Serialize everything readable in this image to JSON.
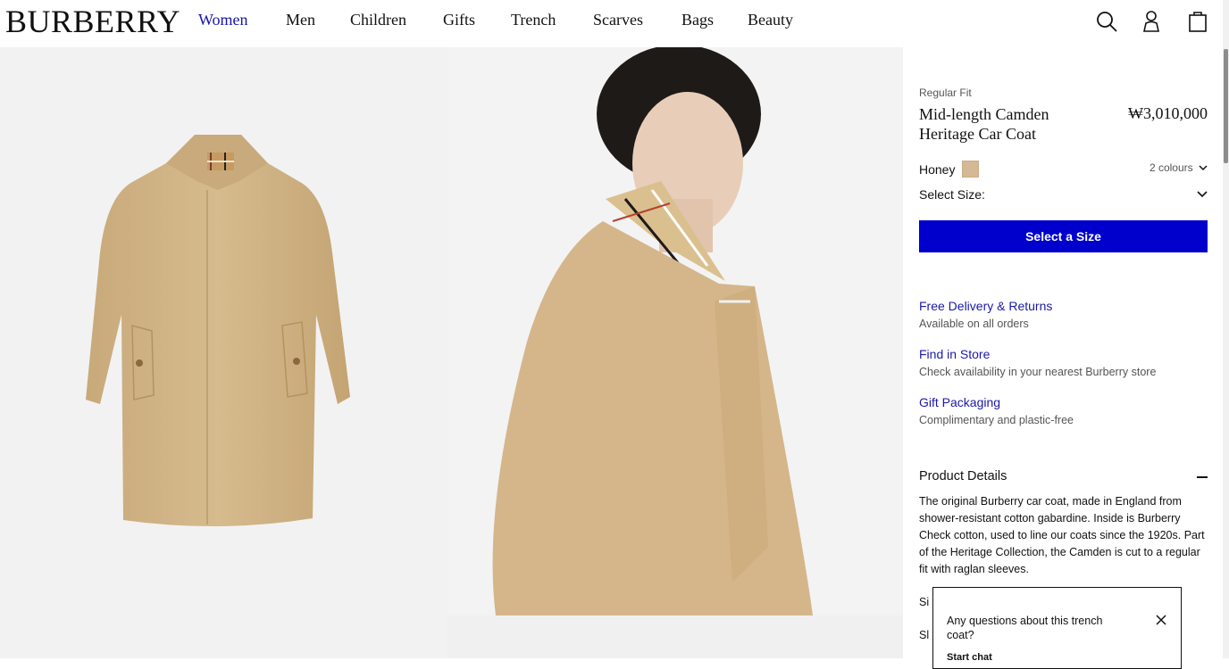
{
  "brand": {
    "logo": "BURBERRY"
  },
  "nav": {
    "items": [
      "Women",
      "Men",
      "Children",
      "Gifts",
      "Trench",
      "Scarves",
      "Bags",
      "Beauty"
    ],
    "active": "Women"
  },
  "header_icons": [
    "search-icon",
    "account-icon",
    "bag-icon"
  ],
  "product": {
    "fit": "Regular Fit",
    "name": "Mid-length Camden Heritage Car Coat",
    "price": "₩3,010,000",
    "colour": "Honey",
    "colour_hex": "#d4b994",
    "colours_link": "2 colours",
    "size_label": "Select Size:",
    "cta": "Select a Size"
  },
  "services": [
    {
      "title": "Free Delivery & Returns",
      "sub": "Available on all orders"
    },
    {
      "title": "Find in Store",
      "sub": "Check availability in your nearest Burberry store"
    },
    {
      "title": "Gift Packaging",
      "sub": "Complimentary and plastic-free"
    }
  ],
  "details": {
    "title": "Product Details",
    "text": "The original Burberry car coat, made in England from shower-resistant cotton gabardine. Inside is Burberry Check cotton, used to line our coats since the 1920s. Part of the Heritage Collection, the Camden is cut to a regular fit with raglan sleeves.",
    "trunc1": "Si",
    "trunc2": "Sl"
  },
  "chat": {
    "question": "Any questions about this trench coat?",
    "start": "Start chat"
  },
  "colors": {
    "accent": "#0000cc",
    "link": "#1a1aa6",
    "active_nav": "#1515a8"
  }
}
